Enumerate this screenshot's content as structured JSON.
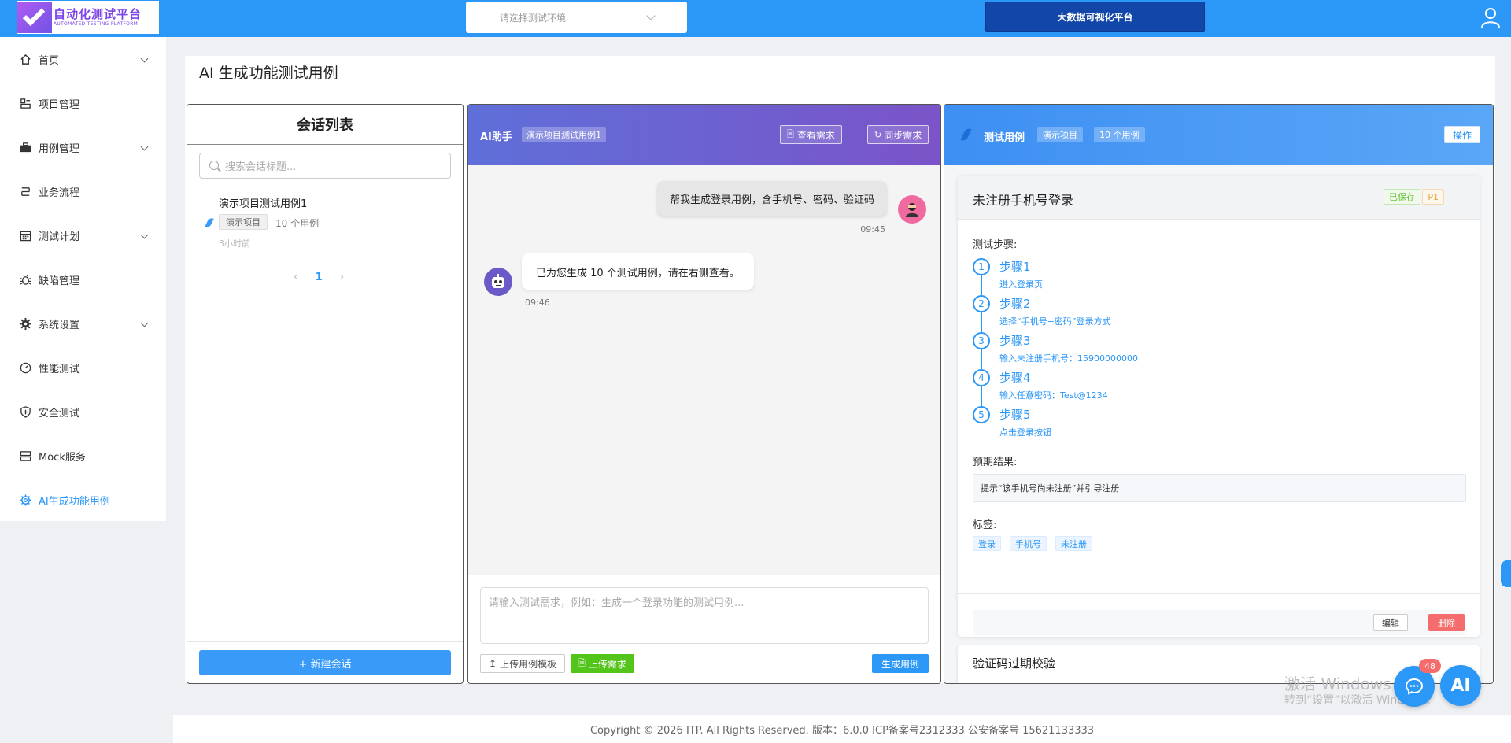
{
  "header": {
    "logo_title": "自动化测试平台",
    "logo_subtitle": "AUTOMATED TESTING PLATFORM",
    "env_placeholder": "请选择测试环境",
    "bigdata_label": "大数据可视化平台"
  },
  "sidebar": {
    "items": [
      {
        "label": "首页",
        "icon": "home-icon",
        "expandable": true
      },
      {
        "label": "项目管理",
        "icon": "project-icon",
        "expandable": false
      },
      {
        "label": "用例管理",
        "icon": "briefcase-icon",
        "expandable": true
      },
      {
        "label": "业务流程",
        "icon": "flow-icon",
        "expandable": false
      },
      {
        "label": "测试计划",
        "icon": "calendar-icon",
        "expandable": true
      },
      {
        "label": "缺陷管理",
        "icon": "bug-icon",
        "expandable": false
      },
      {
        "label": "系统设置",
        "icon": "gear-icon",
        "expandable": true
      },
      {
        "label": "性能测试",
        "icon": "gauge-icon",
        "expandable": false
      },
      {
        "label": "安全测试",
        "icon": "shield-icon",
        "expandable": false
      },
      {
        "label": "Mock服务",
        "icon": "server-icon",
        "expandable": false
      },
      {
        "label": "AI生成功能用例",
        "icon": "ai-gear-icon",
        "expandable": false,
        "active": true
      }
    ]
  },
  "page": {
    "title": "AI 生成功能测试用例"
  },
  "sessions": {
    "heading": "会话列表",
    "search_placeholder": "搜索会话标题...",
    "items": [
      {
        "title": "演示项目测试用例1",
        "project": "演示项目",
        "count": "10 个用例",
        "time": "3小时前"
      }
    ],
    "pager": {
      "prev": "‹",
      "current": "1",
      "next": "›"
    },
    "new_button": "+ 新建会话"
  },
  "chat": {
    "title": "AI助手",
    "tag": "演示项目测试用例1",
    "view_req": "查看需求",
    "sync_req": "同步需求",
    "messages": [
      {
        "role": "user",
        "text": "帮我生成登录用例，含手机号、密码、验证码",
        "time": "09:45"
      },
      {
        "role": "bot",
        "text": "已为您生成 10 个测试用例，请在右侧查看。",
        "time": "09:46"
      }
    ],
    "input_placeholder": "请输入测试需求，例如：生成一个登录功能的测试用例...",
    "upload_template": "上传用例模板",
    "upload_req": "上传需求",
    "generate": "生成用例"
  },
  "testcases": {
    "title": "测试用例",
    "project_tag": "演示项目",
    "count_tag": "10 个用例",
    "op_button": "操作",
    "case": {
      "title": "未注册手机号登录",
      "saved": "已保存",
      "priority": "P1",
      "steps_label": "测试步骤:",
      "steps": [
        {
          "num": "1",
          "name": "步骤1",
          "desc": "进入登录页"
        },
        {
          "num": "2",
          "name": "步骤2",
          "desc": "选择“手机号+密码”登录方式"
        },
        {
          "num": "3",
          "name": "步骤3",
          "desc": "输入未注册手机号：15900000000"
        },
        {
          "num": "4",
          "name": "步骤4",
          "desc": "输入任意密码：Test@1234"
        },
        {
          "num": "5",
          "name": "步骤5",
          "desc": "点击登录按钮"
        }
      ],
      "expected_label": "预期结果:",
      "expected": "提示“该手机号尚未注册”并引导注册",
      "tags_label": "标签:",
      "tags": [
        "登录",
        "手机号",
        "未注册"
      ],
      "edit": "编辑",
      "delete": "删除"
    },
    "next_case_title": "验证码过期校验"
  },
  "floating": {
    "badge": "48",
    "ai_label": "AI",
    "watermark_line1": "激活 Windows",
    "watermark_line2": "转到“设置”以激活 Windows。"
  },
  "footer": {
    "text": "Copyright © 2026 ITP. All Rights Reserved. 版本：6.0.0 ICP备案号2312333 公安备案号 15621133333"
  },
  "colors": {
    "primary": "#2b97f7",
    "chat_header": "#6a5ac8",
    "success": "#52c41a",
    "danger": "#f56c6c"
  }
}
